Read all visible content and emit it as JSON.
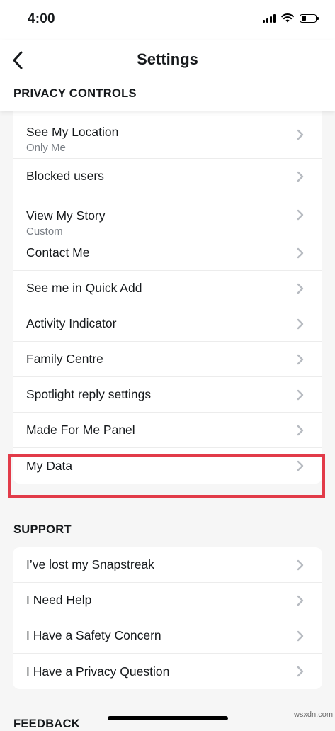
{
  "status_bar": {
    "time": "4:00"
  },
  "nav": {
    "title": "Settings"
  },
  "sections": {
    "privacy": {
      "header": "PRIVACY CONTROLS",
      "items": [
        {
          "label": "See My Location",
          "sublabel": "Only Me"
        },
        {
          "label": "Blocked users"
        },
        {
          "label": "View My Story",
          "sublabel": "Custom"
        },
        {
          "label": "Contact Me"
        },
        {
          "label": "See me in Quick Add"
        },
        {
          "label": "Activity Indicator"
        },
        {
          "label": "Family Centre"
        },
        {
          "label": "Spotlight reply settings"
        },
        {
          "label": "Made For Me Panel"
        },
        {
          "label": "My Data"
        }
      ]
    },
    "support": {
      "header": "SUPPORT",
      "items": [
        {
          "label": "I’ve lost my Snapstreak"
        },
        {
          "label": "I Need Help"
        },
        {
          "label": "I Have a Safety Concern"
        },
        {
          "label": "I Have a Privacy Question"
        }
      ]
    },
    "feedback": {
      "header": "FEEDBACK"
    }
  },
  "highlight": {
    "target": "My Data",
    "color": "#e23b49"
  },
  "icons": {
    "back": "chevron-left-icon",
    "row": "chevron-right-icon"
  },
  "colors": {
    "background": "#f6f6f6",
    "card": "#ffffff",
    "secondary_text": "#7a7f86",
    "chevron": "#b7bbc1"
  },
  "watermark": "wsxdn.com"
}
